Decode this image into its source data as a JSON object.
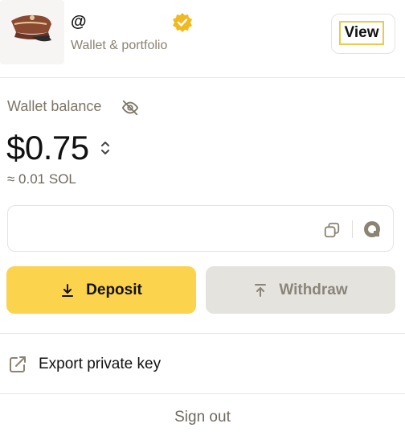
{
  "profile": {
    "username": "@",
    "subtitle": "Wallet & portfolio",
    "view_label": "View"
  },
  "balance": {
    "label": "Wallet balance",
    "value": "$0.75",
    "sol_value": "≈ 0.01 SOL"
  },
  "address": {
    "value": ""
  },
  "actions": {
    "deposit_label": "Deposit",
    "withdraw_label": "Withdraw"
  },
  "menu": {
    "export_label": "Export private key",
    "sign_out_label": "Sign out"
  },
  "icons": [
    "avatar",
    "verified-badge-icon",
    "eye-off-icon",
    "sort-icon",
    "copy-icon",
    "qr-code-icon",
    "download-icon",
    "upload-icon",
    "external-link-icon"
  ],
  "colors": {
    "accent": "#fcd34d",
    "verified": "#f2b91e",
    "muted_text": "#8b8374",
    "disabled_bg": "#e5e3de"
  }
}
